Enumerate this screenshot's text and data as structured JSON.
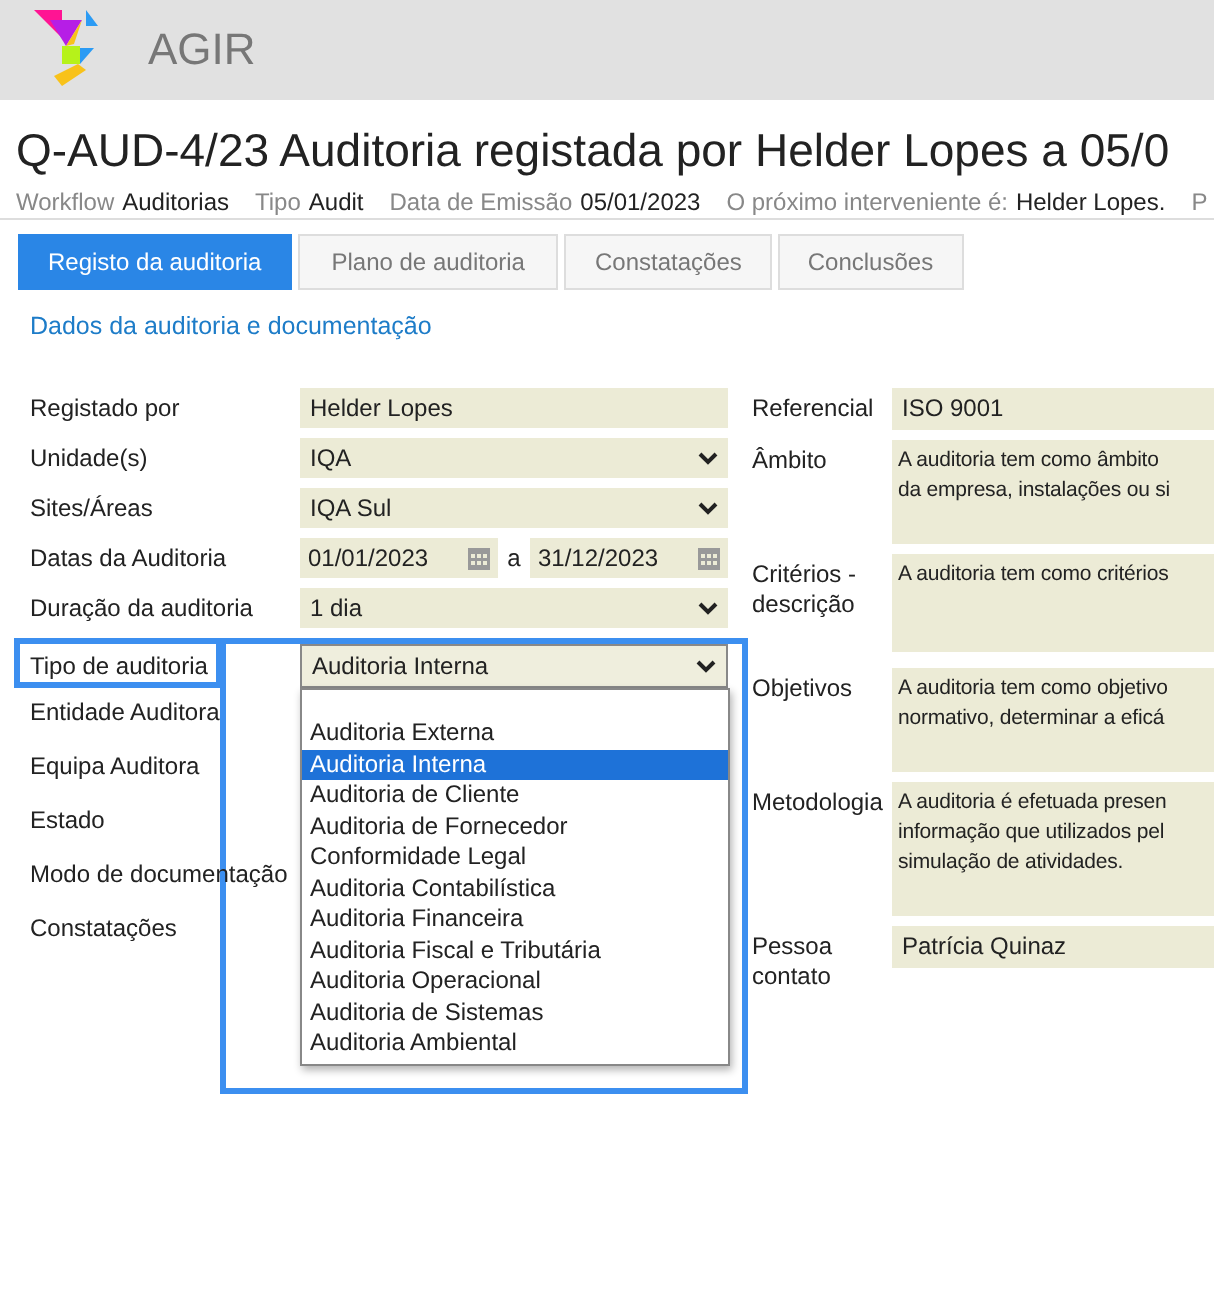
{
  "app": {
    "name": "AGIR"
  },
  "record": {
    "title": "Q-AUD-4/23 Auditoria registada por Helder Lopes a 05/0",
    "meta": [
      {
        "label": "Workflow",
        "value": "Auditorias"
      },
      {
        "label": "Tipo",
        "value": "Audit"
      },
      {
        "label": "Data de Emissão",
        "value": "05/01/2023"
      },
      {
        "label": "O próximo interveniente é:",
        "value": "Helder Lopes."
      },
      {
        "label": "P"
      }
    ]
  },
  "tabs": [
    {
      "label": "Registo da auditoria",
      "selected": true
    },
    {
      "label": "Plano de auditoria",
      "selected": false
    },
    {
      "label": "Constatações",
      "selected": false
    },
    {
      "label": "Conclusões",
      "selected": false
    }
  ],
  "section": {
    "title": "Dados da auditoria e documentação"
  },
  "left_fields": [
    {
      "label": "Registado por",
      "kind": "text",
      "value": "Helder Lopes"
    },
    {
      "label": "Unidade(s)",
      "kind": "select",
      "value": "IQA"
    },
    {
      "label": "Sites/Áreas",
      "kind": "select",
      "value": "IQA Sul"
    },
    {
      "label": "Datas da Auditoria",
      "kind": "dates",
      "from": "01/01/2023",
      "separator": "a",
      "to": "31/12/2023"
    },
    {
      "label": "Duração da auditoria",
      "kind": "select",
      "value": "1 dia"
    },
    {
      "label": "Tipo de auditoria",
      "kind": "select",
      "value": "Auditoria Interna",
      "highlighted": true,
      "expanded": true,
      "options": [
        {
          "label": "Auditoria Externa",
          "selected": false
        },
        {
          "label": "Auditoria Interna",
          "selected": true
        },
        {
          "label": "Auditoria de Cliente",
          "selected": false
        },
        {
          "label": "Auditoria de Fornecedor",
          "selected": false
        },
        {
          "label": "Conformidade Legal",
          "selected": false
        },
        {
          "label": "Auditoria Contabilística",
          "selected": false
        },
        {
          "label": "Auditoria Financeira",
          "selected": false
        },
        {
          "label": "Auditoria Fiscal e Tributária",
          "selected": false
        },
        {
          "label": "Auditoria Operacional",
          "selected": false
        },
        {
          "label": "Auditoria de Sistemas",
          "selected": false
        },
        {
          "label": "Auditoria Ambiental",
          "selected": false
        }
      ]
    },
    {
      "label": "Entidade Auditora",
      "kind": "none"
    },
    {
      "label": "Equipa Auditora",
      "kind": "none"
    },
    {
      "label": "Estado",
      "kind": "none"
    },
    {
      "label": "Modo de documentação",
      "kind": "none"
    },
    {
      "label": "Constatações",
      "kind": "none"
    }
  ],
  "right_fields": [
    {
      "label": "Referencial",
      "kind": "text",
      "value": "ISO 9001"
    },
    {
      "label": "Âmbito",
      "kind": "textarea",
      "lines": [
        "A auditoria tem como âmbito",
        "da empresa, instalações ou si"
      ]
    },
    {
      "label": "Critérios - descrição",
      "kind": "textarea",
      "lines": [
        "A auditoria tem como critérios"
      ]
    },
    {
      "label": "Objetivos",
      "kind": "textarea",
      "lines": [
        "A auditoria tem como objetivo",
        "normativo, determinar a eficá"
      ]
    },
    {
      "label": "Metodologia",
      "kind": "textarea",
      "lines": [
        "A auditoria é efetuada presen",
        "informação que  utilizados pel",
        "simulação de atividades."
      ]
    },
    {
      "label": "Pessoa contato",
      "kind": "text",
      "value": "Patrícia Quinaz"
    }
  ]
}
